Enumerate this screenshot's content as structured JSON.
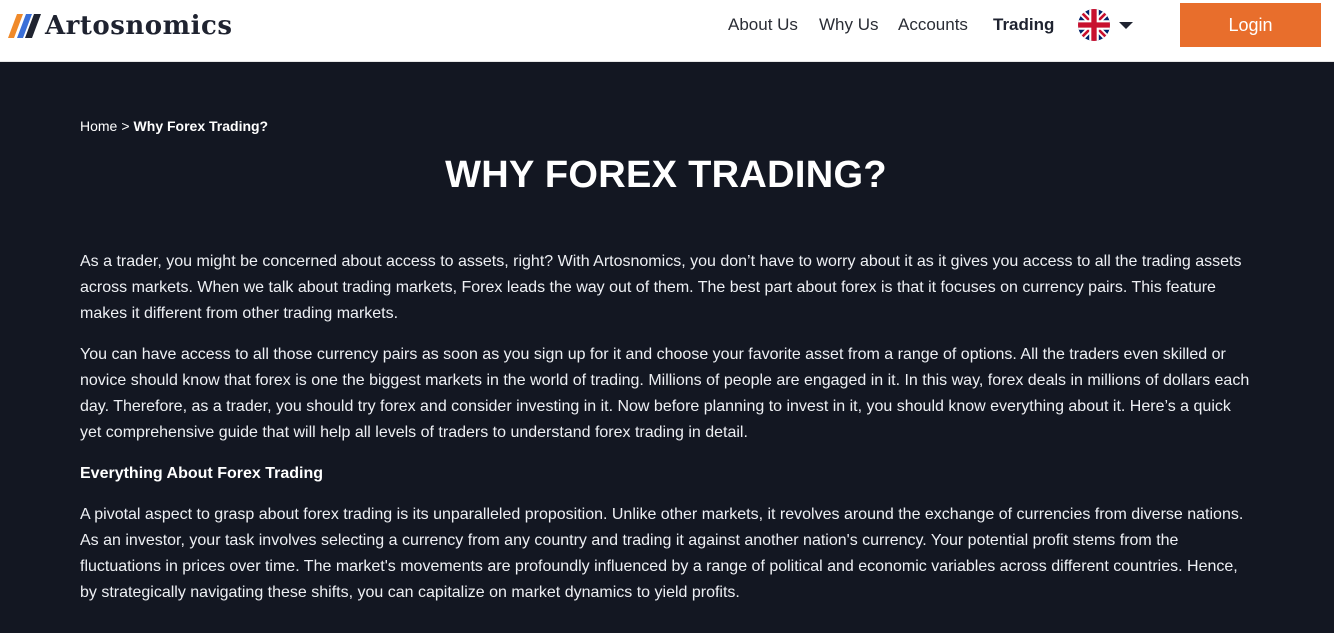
{
  "brand": {
    "name": "Artosnomics"
  },
  "nav": {
    "items": [
      {
        "label": "About Us"
      },
      {
        "label": "Why Us"
      },
      {
        "label": "Accounts"
      },
      {
        "label": "Trading"
      }
    ],
    "active": "Trading",
    "language_icon": "uk-flag-icon",
    "login_label": "Login"
  },
  "breadcrumb": {
    "home": "Home",
    "separator": ">",
    "current": "Why Forex Trading?"
  },
  "page": {
    "title": "WHY FOREX TRADING?",
    "paragraphs": [
      "As a trader, you might be concerned about access to assets, right? With Artosnomics, you don’t have to worry about it as it gives you access to all the trading assets across markets. When we talk about trading markets, Forex leads the way out of them. The best part about forex is that it focuses on currency pairs. This feature makes it different from other trading markets.",
      "You can have access to all those currency pairs as soon as you sign up for it and choose your favorite asset from a range of options. All the traders even skilled or novice should know that forex is one the biggest markets in the world of trading. Millions of people are engaged in it. In this way, forex deals in millions of dollars each day. Therefore, as a trader, you should try forex and consider investing in it. Now before planning to invest in it, you should know everything about it. Here’s a quick yet comprehensive guide that will help all levels of traders to understand forex trading in detail."
    ],
    "subheading": "Everything About Forex Trading",
    "paragraph3": "A pivotal aspect to grasp about forex trading is its unparalleled proposition. Unlike other markets, it revolves around the exchange of currencies from diverse nations. As an investor, your task involves selecting a currency from any country and trading it against another nation's currency. Your potential profit stems from the fluctuations in prices over time. The market's movements are profoundly influenced by a range of political and economic variables across different countries. Hence, by strategically navigating these shifts, you can capitalize on market dynamics to yield profits."
  },
  "colors": {
    "accent": "#e86e2c",
    "background": "#131722",
    "header_bg": "#ffffff",
    "logo_blue": "#3a6fd8",
    "logo_orange": "#f08a2a"
  }
}
